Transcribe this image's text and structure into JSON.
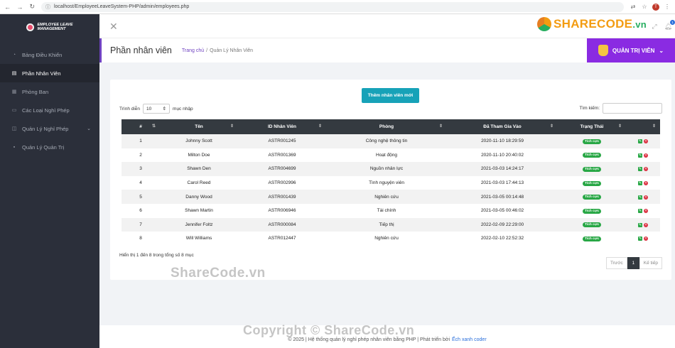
{
  "browser": {
    "url": "localhost/EmployeeLeaveSystem-PHP/admin/employees.php",
    "profile_initial": "T"
  },
  "brand": {
    "logo_line1": "Employee Leave",
    "logo_line2": "Management",
    "sharecode_main": "SHARECODE",
    "sharecode_suffix": ".vn",
    "notification_count": "1"
  },
  "sidebar": {
    "items": [
      {
        "label": "Bảng Điều Khiển",
        "icon": "dashboard-icon"
      },
      {
        "label": "Phần Nhân Viên",
        "icon": "employee-icon"
      },
      {
        "label": "Phòng Ban",
        "icon": "department-icon"
      },
      {
        "label": "Các Loại Nghỉ Phép",
        "icon": "leave-type-icon"
      },
      {
        "label": "Quản Lý Nghỉ Phép",
        "icon": "leave-manage-icon"
      },
      {
        "label": "Quản Lý Quản Trị",
        "icon": "lock-icon"
      }
    ]
  },
  "header": {
    "page_title": "Phần nhân viên",
    "breadcrumb_home": "Trang chủ",
    "breadcrumb_sep": "/",
    "breadcrumb_current": "Quản Lý Nhân Viên",
    "admin_label": "QUẢN TRỊ VIÊN"
  },
  "main": {
    "add_button": "Thêm nhân viên mới",
    "length_label_pre": "Trình diễn",
    "length_value": "10",
    "length_label_post": "mục nhập",
    "search_label": "Tìm kiếm:",
    "columns": [
      "#",
      "Tên",
      "ID Nhân Viên",
      "Phòng",
      "Đã Tham Gia Vào",
      "Trạng Thái",
      ""
    ],
    "rows": [
      {
        "no": "1",
        "name": "Johnny Scott",
        "id": "ASTR001245",
        "dept": "Công nghệ thông tin",
        "joined": "2020-11-10 18:29:59",
        "status": "Tích cực"
      },
      {
        "no": "2",
        "name": "Milton Doe",
        "id": "ASTR001369",
        "dept": "Hoạt động",
        "joined": "2020-11-10 20:40:02",
        "status": "Tích cực"
      },
      {
        "no": "3",
        "name": "Shawn Den",
        "id": "ASTR004699",
        "dept": "Nguồn nhân lực",
        "joined": "2021-03-03 14:24:17",
        "status": "Tích cực"
      },
      {
        "no": "4",
        "name": "Carol Reed",
        "id": "ASTR002996",
        "dept": "Tình nguyện viên",
        "joined": "2021-03-03 17:44:13",
        "status": "Tích cực"
      },
      {
        "no": "5",
        "name": "Danny Wood",
        "id": "ASTR001439",
        "dept": "Nghiên cứu",
        "joined": "2021-03-05 00:14:48",
        "status": "Tích cực"
      },
      {
        "no": "6",
        "name": "Shawn Martin",
        "id": "ASTR006946",
        "dept": "Tài chính",
        "joined": "2021-03-05 00:46:02",
        "status": "Tích cực"
      },
      {
        "no": "7",
        "name": "Jennifer Foltz",
        "id": "ASTR000084",
        "dept": "Tiếp thị",
        "joined": "2022-02-09 22:29:00",
        "status": "Tích cực"
      },
      {
        "no": "8",
        "name": "Will Williams",
        "id": "ASTR012447",
        "dept": "Nghiên cứu",
        "joined": "2022-02-10 22:52:32",
        "status": "Tích cực"
      }
    ],
    "info_text": "Hiển thị 1 đến 8 trong tổng số 8 mục",
    "pager_prev": "Trước",
    "pager_current": "1",
    "pager_next": "Kế tiếp"
  },
  "footer": {
    "text": "© 2025 | Hệ thống quản lý nghỉ phép nhân viên bằng PHP | Phát triển bởi",
    "link": "Ếch xanh coder"
  },
  "watermarks": {
    "center": "ShareCode.vn",
    "bottom": "Copyright © ShareCode.vn"
  },
  "colors": {
    "sidebar": "#2b2f3a",
    "accent_purple": "#8a2be2",
    "add_button": "#17a2b8",
    "status_badge": "#28a745",
    "table_header": "#343a40"
  }
}
